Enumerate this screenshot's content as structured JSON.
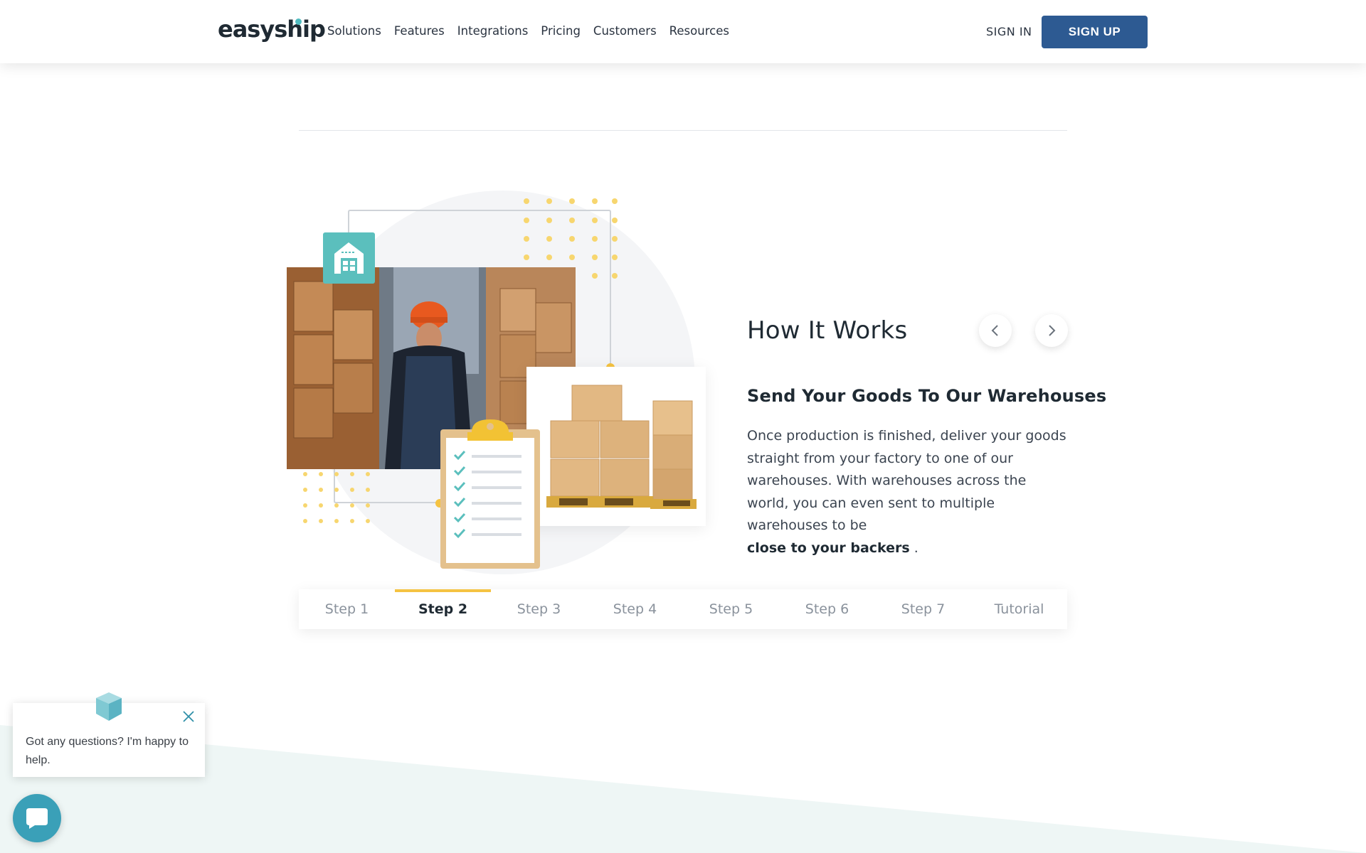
{
  "header": {
    "logo_text": "easyship",
    "nav": [
      "Solutions",
      "Features",
      "Integrations",
      "Pricing",
      "Customers",
      "Resources"
    ],
    "sign_in": "SIGN IN",
    "sign_up": "SIGN UP"
  },
  "how_it_works": {
    "title": "How It Works",
    "prev_icon": "chevron-left-icon",
    "next_icon": "chevron-right-icon",
    "step_title": "Send Your Goods To Our Warehouses",
    "step_body": "Once production is finished, deliver your goods straight from your factory to one of our warehouses. With warehouses across the world, you can even sent to multiple warehouses to be",
    "step_body_bold": "close to your backers",
    "step_body_end": " ."
  },
  "steps": [
    {
      "label": "Step 1",
      "active": false
    },
    {
      "label": "Step 2",
      "active": true
    },
    {
      "label": "Step 3",
      "active": false
    },
    {
      "label": "Step 4",
      "active": false
    },
    {
      "label": "Step 5",
      "active": false
    },
    {
      "label": "Step 6",
      "active": false
    },
    {
      "label": "Step 7",
      "active": false
    },
    {
      "label": "Tutorial",
      "active": false
    }
  ],
  "chat": {
    "message": "Got any questions? I'm happy to help.",
    "close_icon": "close-icon",
    "launcher_icon": "chat-bubble-icon"
  },
  "colors": {
    "brand_blue": "#2d5a92",
    "teal": "#5bbfbd",
    "accent_yellow": "#f5c342",
    "chat_launcher": "#3aa0b8"
  }
}
